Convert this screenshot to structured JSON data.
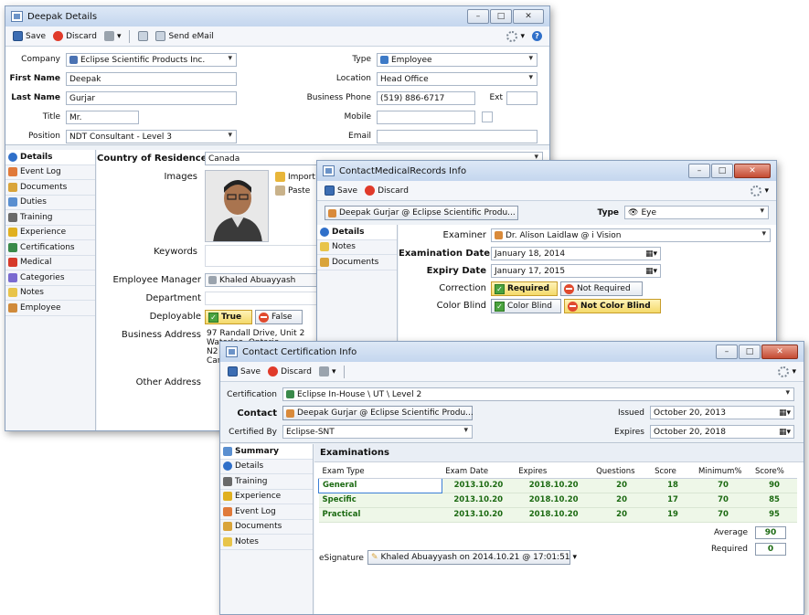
{
  "win1": {
    "title": "Deepak Details",
    "toolbar": {
      "save": "Save",
      "discard": "Discard",
      "send_email": "Send eMail"
    },
    "company_label": "Company",
    "company_value": "Eclipse Scientific Products Inc.",
    "type_label": "Type",
    "type_value": "Employee",
    "first_name_label": "First Name",
    "first_name_value": "Deepak",
    "location_label": "Location",
    "location_value": "Head Office",
    "last_name_label": "Last Name",
    "last_name_value": "Gurjar",
    "business_phone_label": "Business Phone",
    "business_phone_value": "(519) 886-6717",
    "ext_label": "Ext",
    "title_label": "Title",
    "title_value": "Mr.",
    "mobile_label": "Mobile",
    "position_label": "Position",
    "position_value": "NDT Consultant - Level 3",
    "email_label": "Email",
    "nav": [
      "Details",
      "Event Log",
      "Documents",
      "Duties",
      "Training",
      "Experience",
      "Certifications",
      "Medical",
      "Categories",
      "Notes",
      "Employee"
    ],
    "country_label": "Country of Residence",
    "country_value": "Canada",
    "images_label": "Images",
    "import": "Import",
    "paste": "Paste",
    "keywords_label": "Keywords",
    "manager_label": "Employee Manager",
    "manager_value": "Khaled Abuayyash",
    "department_label": "Department",
    "deployable_label": "Deployable",
    "true_label": "True",
    "false_label": "False",
    "business_address_label": "Business Address",
    "address_lines": [
      "97 Randall Drive, Unit 2",
      "Waterloo, Ontario",
      "N2",
      "Car"
    ],
    "other_address_label": "Other Address"
  },
  "win2": {
    "title": "ContactMedicalRecords Info",
    "save": "Save",
    "discard": "Discard",
    "contact_value": "Deepak Gurjar @ Eclipse Scientific Produ...",
    "type_label": "Type",
    "type_value": "Eye",
    "nav": [
      "Details",
      "Notes",
      "Documents"
    ],
    "examiner_label": "Examiner",
    "examiner_value": "Dr. Alison Laidlaw @ i Vision",
    "exam_date_label": "Examination Date",
    "exam_date_value": "January  18, 2014",
    "expiry_label": "Expiry Date",
    "expiry_value": "January  17, 2015",
    "correction_label": "Correction",
    "required": "Required",
    "not_required": "Not Required",
    "color_blind_label": "Color Blind",
    "color_blind": "Color Blind",
    "not_color_blind": "Not Color Blind"
  },
  "win3": {
    "title": "Contact Certification Info",
    "save": "Save",
    "discard": "Discard",
    "certification_label": "Certification",
    "certification_value": "Eclipse In-House \\ UT \\ Level 2",
    "contact_label": "Contact",
    "contact_value": "Deepak Gurjar @ Eclipse Scientific Produ...",
    "issued_label": "Issued",
    "issued_value": "October  20, 2013",
    "certified_by_label": "Certified By",
    "certified_by_value": "Eclipse-SNT",
    "expires_label": "Expires",
    "expires_value": "October  20, 2018",
    "nav": [
      "Summary",
      "Details",
      "Training",
      "Experience",
      "Event Log",
      "Documents",
      "Notes"
    ],
    "examinations_title": "Examinations",
    "columns": [
      "Exam Type",
      "Exam Date",
      "Expires",
      "Questions",
      "Score",
      "Minimum%",
      "Score%"
    ],
    "rows": [
      [
        "General",
        "2013.10.20",
        "2018.10.20",
        "20",
        "18",
        "70",
        "90"
      ],
      [
        "Specific",
        "2013.10.20",
        "2018.10.20",
        "20",
        "17",
        "70",
        "85"
      ],
      [
        "Practical",
        "2013.10.20",
        "2018.10.20",
        "20",
        "19",
        "70",
        "95"
      ]
    ],
    "average_label": "Average",
    "average_value": "90",
    "required_label": "Required",
    "required_value": "0",
    "esignature_label": "eSignature",
    "esignature_value": "Khaled Abuayyash on 2014.10.21 @ 17:01:51"
  }
}
